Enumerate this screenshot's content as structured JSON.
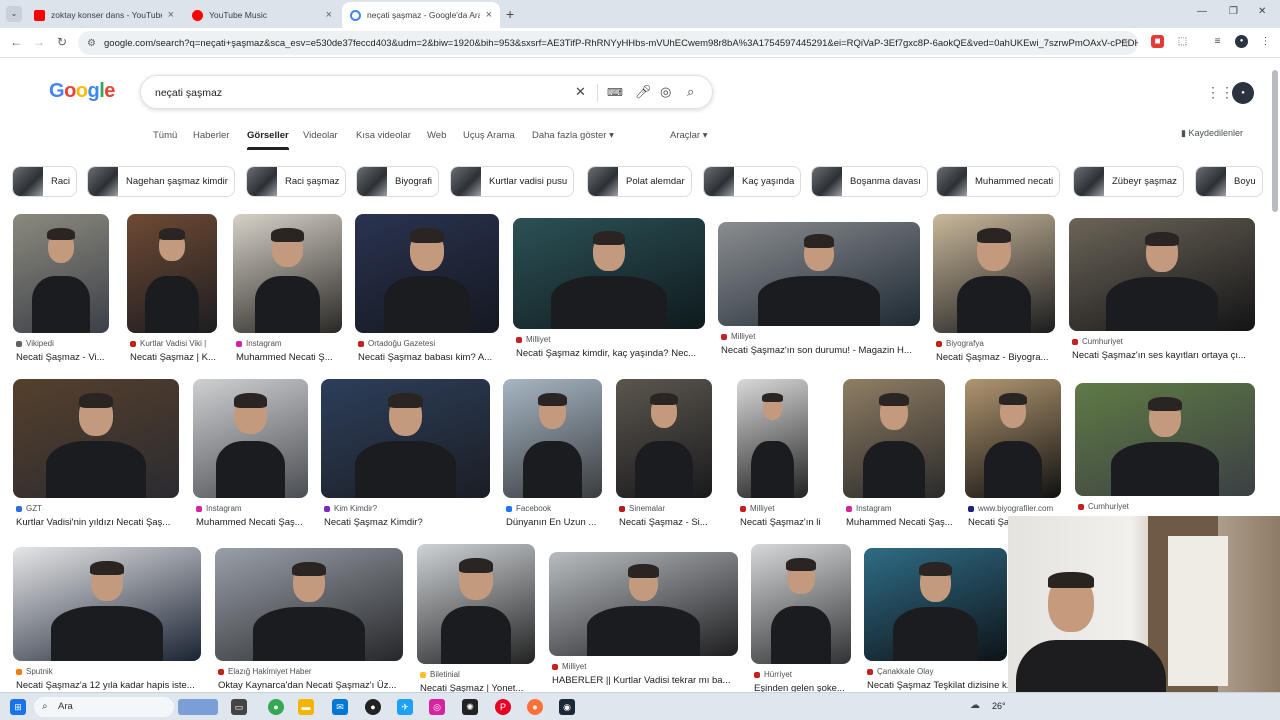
{
  "browser": {
    "tabs": [
      {
        "title": "zoktay konser dans - YouTube",
        "icon_color": "#ff0000",
        "active": false
      },
      {
        "title": "YouTube Music",
        "icon_color": "#ff0000",
        "active": false
      },
      {
        "title": "neçati şaşmaz - Google'da Ara",
        "icon_color": "#4285f4",
        "active": true
      }
    ],
    "new_tab_label": "+",
    "url": "google.com/search?q=neçati+şaşmaz&sca_esv=e530de37feccd403&udm=2&biw=1920&bih=953&sxsrf=AE3TifP-RhRNYyHHbs-mVUhECwem98r8bA%3A1754597445291&ei=RQiVaP-3Ef7gxc8P-6aokQE&ved=0ahUKEwi_7szrwPmOAxV-cPEDH..."
  },
  "google": {
    "logo": "Google",
    "logo_colors": [
      "#4285f4",
      "#ea4335",
      "#fbbc05",
      "#4285f4",
      "#34a853",
      "#ea4335"
    ],
    "query": "neçati şaşmaz",
    "nav_tabs": [
      "Tümü",
      "Haberler",
      "Görseller",
      "Videolar",
      "Kısa videolar",
      "Web",
      "Uçuş Arama",
      "Daha fazla göster ▾"
    ],
    "active_tab": "Görseller",
    "tools": "Araçlar ▾",
    "saved": "Kaydedilenler",
    "chips": [
      "Raci",
      "Nagehan şaşmaz kimdir",
      "Raci şaşmaz",
      "Biyografi",
      "Kurtlar vadisi pusu",
      "Polat alemdar",
      "Kaç yaşında",
      "Boşanma davası",
      "Muhammed necati",
      "Zübeyr şaşmaz",
      "Boyu"
    ],
    "results": [
      {
        "source": "Vikipedi",
        "title": "Necati Şaşmaz - Vi...",
        "color": "#5f6368"
      },
      {
        "source": "Kurtlar Vadisi Viki |",
        "title": "Necati Şaşmaz | K...",
        "color": "#c5221f"
      },
      {
        "source": "Instagram",
        "title": "Muhammed Necati Ş...",
        "color": "#d6249f"
      },
      {
        "source": "Ortadoğu Gazetesi",
        "title": "Necati Şaşmaz babası kim? A...",
        "color": "#c5221f"
      },
      {
        "source": "Milliyet",
        "title": "Necati Şaşmaz kimdir, kaç yaşında? Nec...",
        "color": "#c5221f"
      },
      {
        "source": "Milliyet",
        "title": "Necati Şaşmaz'ın son durumu! - Magazin H...",
        "color": "#c5221f"
      },
      {
        "source": "Biyografya",
        "title": "Necati Şaşmaz - Biyogra...",
        "color": "#c5221f"
      },
      {
        "source": "Cumhuriyet",
        "title": "Necati Şaşmaz'ın ses kayıtları ortaya çı...",
        "color": "#c5221f"
      },
      {
        "source": "GZT",
        "title": "Kurtlar Vadisi'nin yıldızı Necati Şaş...",
        "color": "#2a6fdb"
      },
      {
        "source": "Instagram",
        "title": "Muhammed Necati Şaş...",
        "color": "#d6249f"
      },
      {
        "source": "Kim Kimdir?",
        "title": "Necati Şaşmaz Kimdir?",
        "color": "#7b2cbf"
      },
      {
        "source": "Facebook",
        "title": "Dünyanın En Uzun ...",
        "color": "#1877f2"
      },
      {
        "source": "Sinemalar",
        "title": "Necati Şaşmaz - Si...",
        "color": "#b71c1c"
      },
      {
        "source": "Milliyet",
        "title": "Necati Şaşmaz'ın li...",
        "color": "#c5221f"
      },
      {
        "source": "Instagram",
        "title": "Muhammed Necati Şaş...",
        "color": "#d6249f"
      },
      {
        "source": "www.biyografiler.com",
        "title": "Necati Şa...",
        "color": "#1a237e"
      },
      {
        "source": "Cumhuriyet",
        "title": "",
        "color": "#c5221f"
      },
      {
        "source": "Sputnik",
        "title": "Necati Şaşmaz'a 12 yıla kadar hapis iste...",
        "color": "#f57c00"
      },
      {
        "source": "Elazığ Hakimiyet Haber",
        "title": "Oktay Kaynarca'dan Necati Şaşmaz'ı Üz...",
        "color": "#c5221f"
      },
      {
        "source": "Biletinial",
        "title": "Necati Şaşmaz | Yonet...",
        "color": "#fbc02d"
      },
      {
        "source": "Milliyet",
        "title": "HABERLER || Kurtlar Vadisi tekrar mı ba...",
        "color": "#c5221f"
      },
      {
        "source": "Hürriyet",
        "title": "Eşinden gelen şoke...",
        "color": "#c5221f"
      },
      {
        "source": "Çanakkale Olay",
        "title": "Necati Şaşmaz Teşkilat dizisine k...",
        "color": "#c5221f"
      }
    ]
  },
  "taskbar": {
    "search_label": "Ara",
    "temperature": "26°"
  }
}
